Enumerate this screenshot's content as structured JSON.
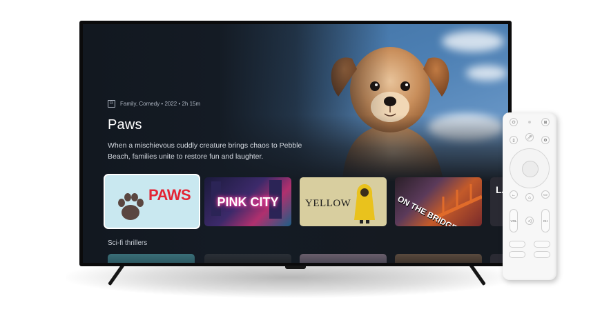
{
  "hero": {
    "rating": "G",
    "meta": "Family, Comedy • 2022 • 2h 15m",
    "title": "Paws",
    "description": "When a mischievous cuddly creature brings chaos to Pebble Beach, families unite to restore fun and laughter."
  },
  "cards": [
    {
      "title": "PAWS",
      "focused": true
    },
    {
      "title": "PINK CITY",
      "focused": false
    },
    {
      "title": "YELLOW",
      "focused": false
    },
    {
      "title": "ON THE BRIDGE",
      "focused": false
    },
    {
      "title": "LA",
      "focused": false
    }
  ],
  "rows": {
    "scifi_label": "Sci-fi thrillers"
  },
  "remote": {
    "vol_label": "VOL",
    "ch_label": "CH"
  },
  "colors": {
    "focus_ring": "#ffffff",
    "screen_bg": "#151a21",
    "paws_red": "#e32434"
  }
}
